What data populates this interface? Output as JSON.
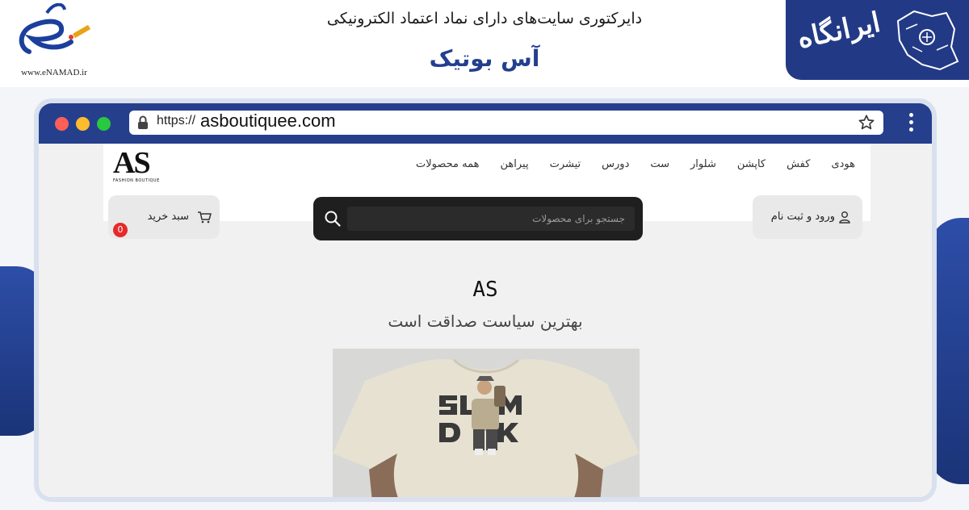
{
  "banner": {
    "enamad_url": "www.eNAMAD.ir",
    "directory_title": "دایرکتوری سایت‌های دارای نماد اعتماد الکترونیکی",
    "site_name": "آس بوتیک",
    "brand": "ایرانگاه",
    "brand_color": "#223a86"
  },
  "browser": {
    "protocol": "https://",
    "host": "asboutiquee.com"
  },
  "site": {
    "logo_text": "AS",
    "logo_tagline": "FASHION BOUTIQUE",
    "nav": [
      "همه محصولات",
      "پیراهن",
      "تیشرت",
      "دورس",
      "ست",
      "شلوار",
      "کاپشن",
      "کفش",
      "هودی"
    ],
    "search_placeholder": "جستجو برای محصولات",
    "login_label": "ورود و ثبت نام",
    "cart_label": "سبد خرید",
    "cart_count": "0",
    "hero_title": "AS",
    "hero_subtitle": "بهترین سیاست صداقت است",
    "product_print": "SLAM DUNK"
  }
}
